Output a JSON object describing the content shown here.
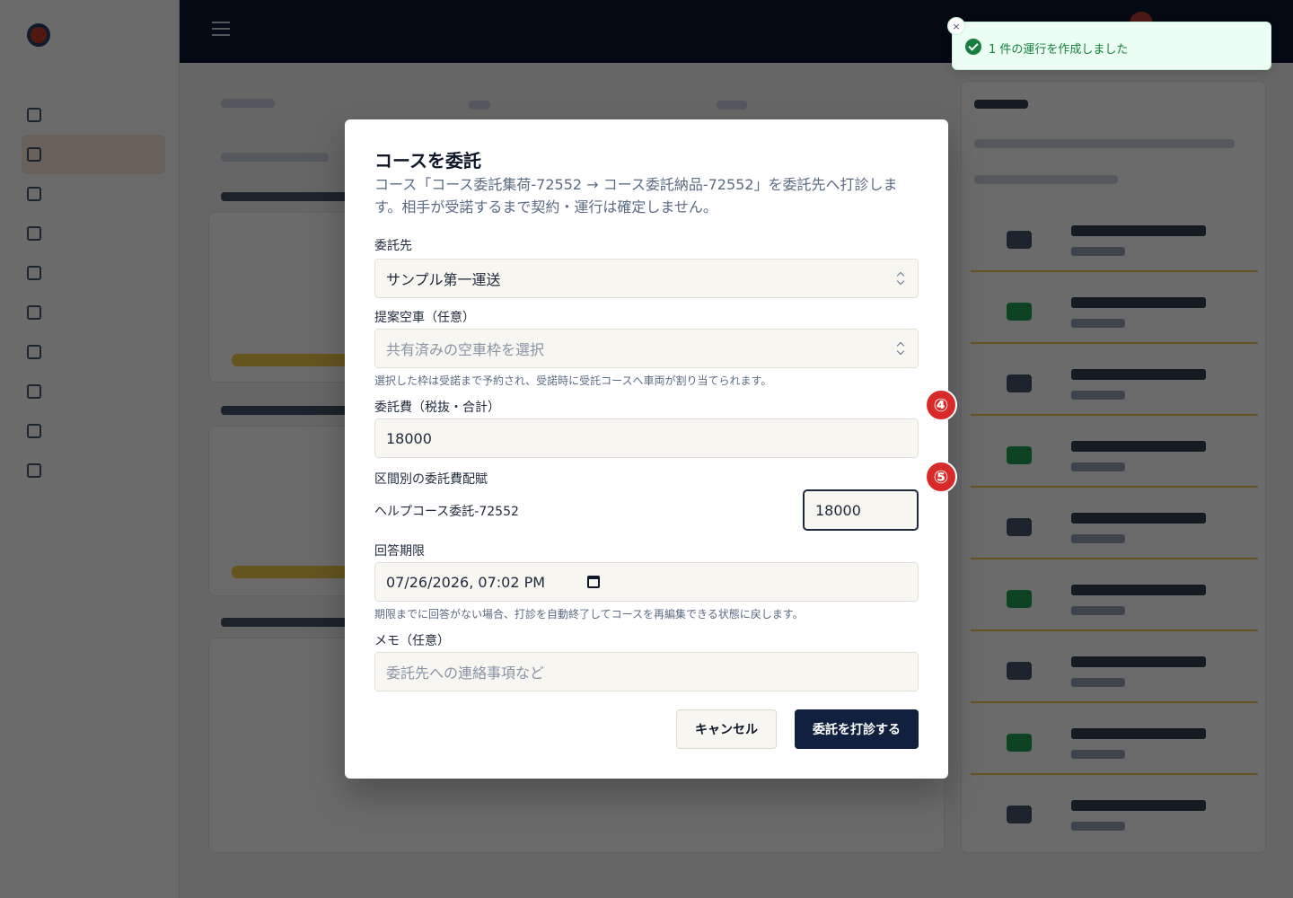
{
  "sidebar": {
    "items": [
      "",
      "",
      "",
      "",
      "",
      "",
      "",
      "",
      "",
      ""
    ]
  },
  "modal": {
    "title": "コースを委託",
    "description": "コース「コース委託集荷-72552 → コース委託納品-72552」を委託先へ打診します。相手が受諾するまで契約・運行は確定しません。",
    "contractor": {
      "label": "委託先",
      "value": "サンプル第一運送"
    },
    "vehicle": {
      "label": "提案空車（任意）",
      "placeholder": "共有済みの空車枠を選択",
      "hint": "選択した枠は受諾まで予約され、受諾時に受託コースへ車両が割り当てられます。"
    },
    "fee": {
      "label": "委託費（税抜・合計）",
      "value": "18000"
    },
    "segment": {
      "label": "区間別の委託費配賦",
      "name": "ヘルプコース委託-72552",
      "value": "18000"
    },
    "deadline": {
      "label": "回答期限",
      "value": "07/26/2026, 07:02 PM",
      "hint": "期限までに回答がない場合、打診を自動終了してコースを再編集できる状態に戻します。"
    },
    "memo": {
      "label": "メモ（任意）",
      "placeholder": "委託先への連絡事項など"
    },
    "cancel_label": "キャンセル",
    "submit_label": "委託を打診する"
  },
  "badges": {
    "step4": "④",
    "step5": "⑤"
  },
  "toast": {
    "message": "1 件の運行を作成しました",
    "close": "×"
  }
}
